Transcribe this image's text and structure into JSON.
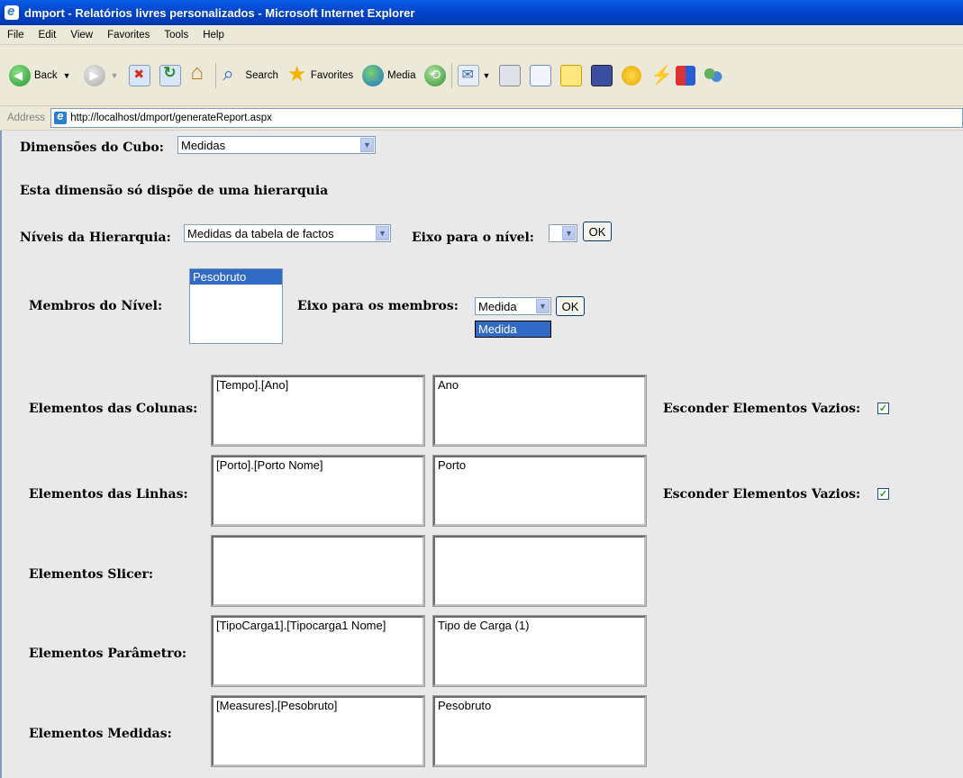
{
  "window": {
    "title": "dmport - Relatórios livres personalizados - Microsoft Internet Explorer"
  },
  "menu": [
    "File",
    "Edit",
    "View",
    "Favorites",
    "Tools",
    "Help"
  ],
  "toolbar": {
    "back": "Back",
    "search": "Search",
    "favorites": "Favorites",
    "media": "Media"
  },
  "address": {
    "label": "Address",
    "url": "http://localhost/dmport/generateReport.aspx"
  },
  "form": {
    "dimensoes_label": "Dimensões do Cubo:",
    "dimensoes_value": "Medidas",
    "hier_info": "Esta dimensão só dispõe de uma hierarquia",
    "niveis_label": "Níveis da Hierarquia:",
    "niveis_value": "Medidas da tabela de factos",
    "eixo_nivel_label": "Eixo para o nível:",
    "eixo_nivel_value": "",
    "ok1": "OK",
    "membros_label": "Membros do Nível:",
    "membros_items": [
      "Pesobruto"
    ],
    "eixo_membros_label": "Eixo para os membros:",
    "eixo_membros_value": "Medida",
    "eixo_membros_option": "Medida",
    "ok2": "OK",
    "rows": [
      {
        "label": "Elementos das Colunas:",
        "left": "[Tempo].[Ano]",
        "right": "Ano",
        "hide_label": "Esconder Elementos Vazios:",
        "hide_checked": true
      },
      {
        "label": "Elementos das Linhas:",
        "left": "[Porto].[Porto Nome]",
        "right": "Porto",
        "hide_label": "Esconder Elementos Vazios:",
        "hide_checked": true
      },
      {
        "label": "Elementos Slicer:",
        "left": "",
        "right": ""
      },
      {
        "label": "Elementos Parâmetro:",
        "left": "[TipoCarga1].[Tipocarga1 Nome]",
        "right": "Tipo de Carga (1)"
      },
      {
        "label": "Elementos Medidas:",
        "left": "[Measures].[Pesobruto]",
        "right": "Pesobruto"
      }
    ]
  }
}
